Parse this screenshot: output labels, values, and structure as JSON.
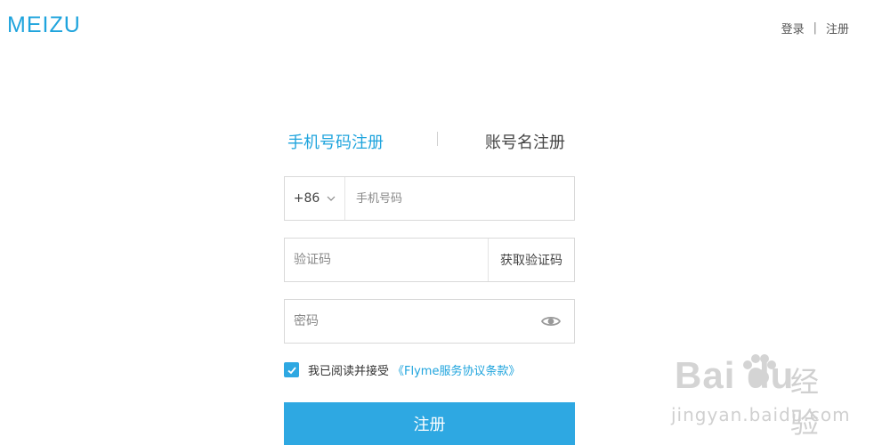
{
  "header": {
    "logo_text": "MEIZU",
    "login_label": "登录",
    "separator": "|",
    "register_label": "注册"
  },
  "tabs": {
    "phone_register": "手机号码注册",
    "account_register": "账号名注册"
  },
  "phone_field": {
    "country_code": "+86",
    "placeholder": "手机号码"
  },
  "code_field": {
    "placeholder": "验证码",
    "get_code_label": "获取验证码"
  },
  "password_field": {
    "placeholder": "密码"
  },
  "agreement": {
    "text": "我已阅读并接受",
    "terms_link": "《Flyme服务协议条款》",
    "checked": true
  },
  "submit_label": "注册",
  "watermark": {
    "brand": "Bai du",
    "cn_text": "经验",
    "url": "jingyan.baidu.com"
  },
  "colors": {
    "accent": "#2ea8e2",
    "logo": "#1fa4dd"
  }
}
